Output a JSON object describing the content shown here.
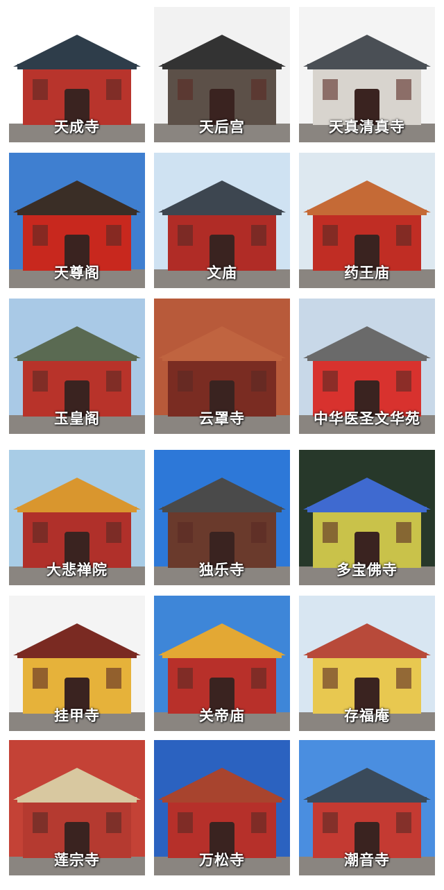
{
  "tiles": [
    {
      "caption": "天成寺",
      "sky": "#ffffff",
      "wall": "#b8342c",
      "roof": "#2e3d4a"
    },
    {
      "caption": "天后宫",
      "sky": "#f2f2f2",
      "wall": "#5c5048",
      "roof": "#333333"
    },
    {
      "caption": "天真清真寺",
      "sky": "#f4f4f4",
      "wall": "#d8d4ce",
      "roof": "#4a4f55"
    },
    {
      "caption": "天尊阁",
      "sky": "#3f7fd0",
      "wall": "#c8281e",
      "roof": "#3a2e26"
    },
    {
      "caption": "文庙",
      "sky": "#cfe2f2",
      "wall": "#b02c26",
      "roof": "#3d4650"
    },
    {
      "caption": "药王庙",
      "sky": "#dde8f0",
      "wall": "#c02d24",
      "roof": "#c56a36"
    },
    {
      "caption": "玉皇阁",
      "sky": "#a9c9e6",
      "wall": "#b8332a",
      "roof": "#5a6a52"
    },
    {
      "caption": "云罩寺",
      "sky": "#b85a3a",
      "wall": "#7a2c22",
      "roof": "#c06440"
    },
    {
      "caption": "中华医圣文华苑",
      "sky": "#c8d8e8",
      "wall": "#d8322e",
      "roof": "#6a6a6a"
    },
    {
      "caption": "大悲禅院",
      "sky": "#a8cce6",
      "wall": "#b0302a",
      "roof": "#d9962e"
    },
    {
      "caption": "独乐寺",
      "sky": "#2d78d8",
      "wall": "#6a3a2c",
      "roof": "#4a4a4a"
    },
    {
      "caption": "多宝佛寺",
      "sky": "#27382a",
      "wall": "#c9c24a",
      "roof": "#3f6ad0"
    },
    {
      "caption": "挂甲寺",
      "sky": "#f4f4f4",
      "wall": "#e6b23a",
      "roof": "#7a2a22"
    },
    {
      "caption": "关帝庙",
      "sky": "#3e86d8",
      "wall": "#b8302a",
      "roof": "#e3a834"
    },
    {
      "caption": "存福庵",
      "sky": "#d8e6f2",
      "wall": "#e8c850",
      "roof": "#b84a3a"
    },
    {
      "caption": "莲宗寺",
      "sky": "#c44236",
      "wall": "#b53a30",
      "roof": "#d8c8a0"
    },
    {
      "caption": "万松寺",
      "sky": "#2b62c0",
      "wall": "#b6302a",
      "roof": "#a8442e"
    },
    {
      "caption": "潮音寺",
      "sky": "#4a8ee0",
      "wall": "#c43a32",
      "roof": "#3a4a5a"
    }
  ]
}
